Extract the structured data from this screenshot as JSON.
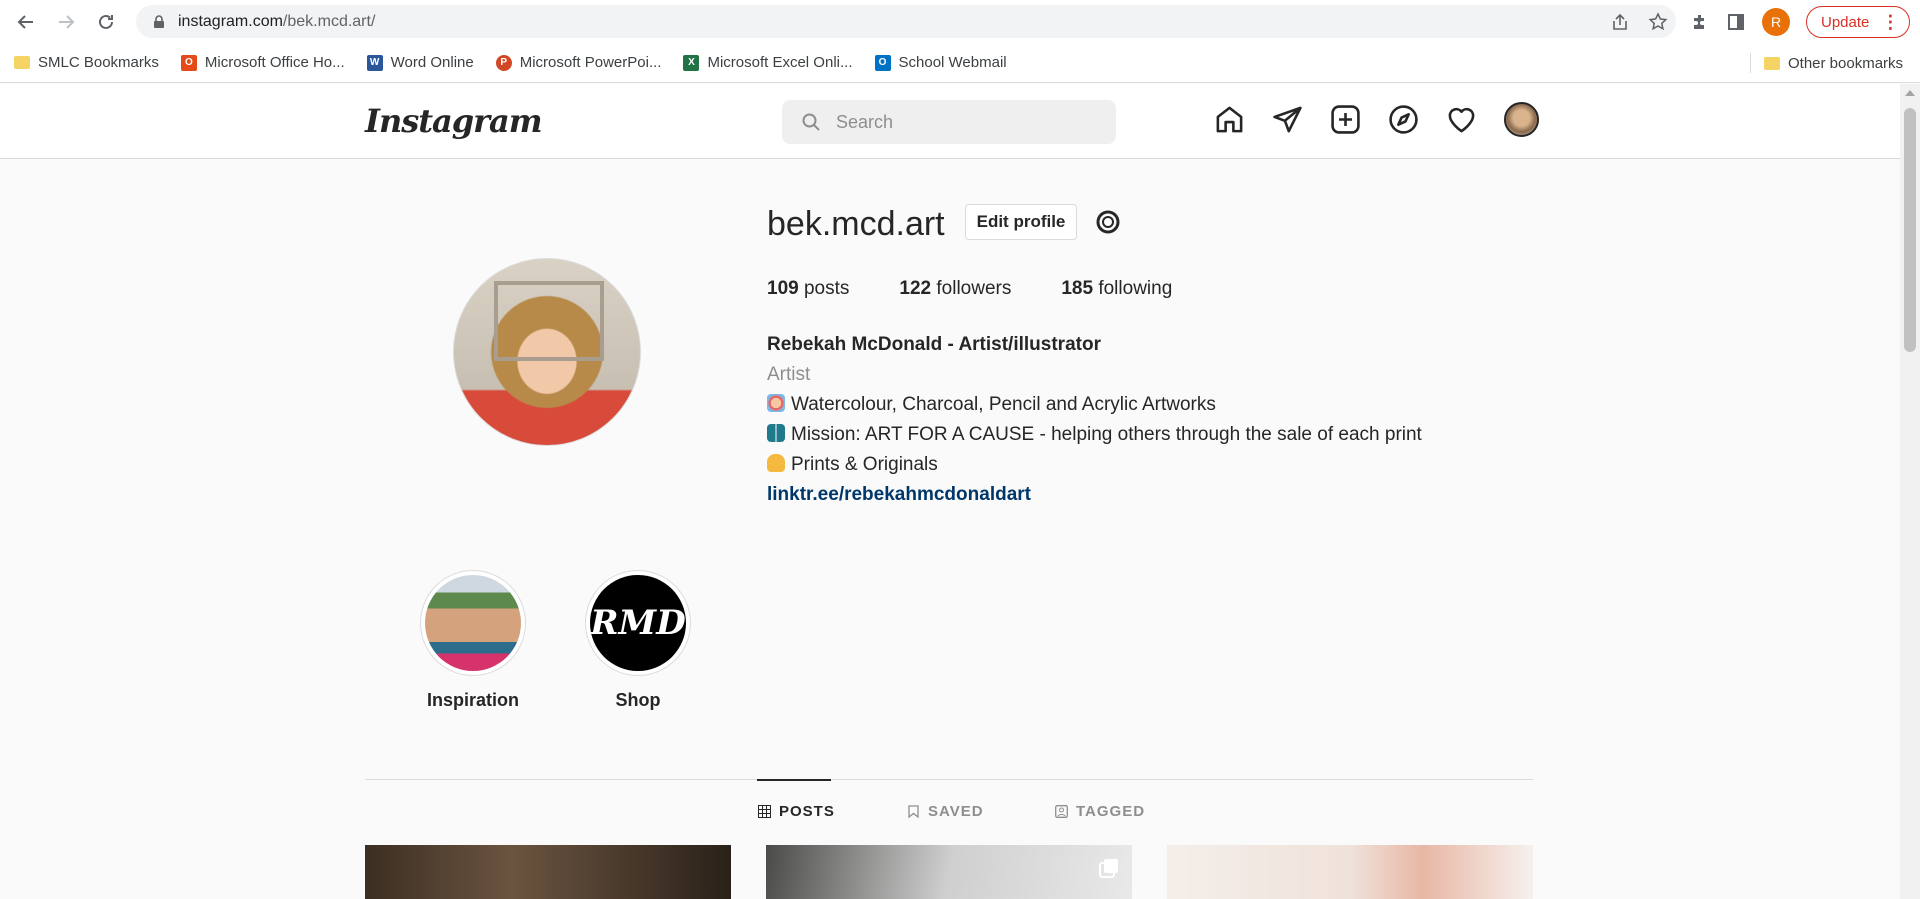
{
  "browser": {
    "url_host": "instagram.com",
    "url_path": "/bek.mcd.art/",
    "profile_initial": "R",
    "update_label": "Update",
    "bookmarks": [
      {
        "label": "SMLC Bookmarks",
        "icon": "folder-icon",
        "color": "#f6d365"
      },
      {
        "label": "Microsoft Office Ho...",
        "icon": "office-icon",
        "color": "#e64a19"
      },
      {
        "label": "Word Online",
        "icon": "word-icon",
        "color": "#2b579a"
      },
      {
        "label": "Microsoft PowerPoi...",
        "icon": "powerpoint-icon",
        "color": "#d24726"
      },
      {
        "label": "Microsoft Excel Onli...",
        "icon": "excel-icon",
        "color": "#217346"
      },
      {
        "label": "School Webmail",
        "icon": "outlook-icon",
        "color": "#0072c6"
      }
    ],
    "other_bookmarks": "Other bookmarks"
  },
  "ig": {
    "logo": "Instagram",
    "search_placeholder": "Search",
    "nav_icons": [
      "home-icon",
      "direct-message-icon",
      "new-post-icon",
      "explore-icon",
      "activity-heart-icon",
      "profile-avatar"
    ]
  },
  "profile": {
    "username": "bek.mcd.art",
    "edit_profile_label": "Edit profile",
    "posts_count": "109",
    "posts_label": " posts",
    "followers_count": "122",
    "followers_label": " followers",
    "following_count": "185",
    "following_label": " following",
    "full_name": "Rebekah McDonald - Artist/illustrator",
    "category": "Artist",
    "bio_lines": [
      {
        "emoji": "palette-emoji",
        "text": "Watercolour, Charcoal, Pencil and Acrylic Artworks"
      },
      {
        "emoji": "book-emoji",
        "text": "Mission: ART FOR A CAUSE - helping others through the sale of each print"
      },
      {
        "emoji": "pointing-down-emoji",
        "text": "Prints & Originals"
      }
    ],
    "link": "linktr.ee/rebekahmcdonaldart"
  },
  "highlights": [
    {
      "label": "Inspiration"
    },
    {
      "label": "Shop",
      "logo_text": "RMD"
    }
  ],
  "tabs": [
    {
      "label": "POSTS",
      "active": true
    },
    {
      "label": "SAVED",
      "active": false
    },
    {
      "label": "TAGGED",
      "active": false
    }
  ],
  "colors": {
    "link": "#00376b",
    "muted": "#8e8e8e",
    "update_red": "#d93025"
  }
}
